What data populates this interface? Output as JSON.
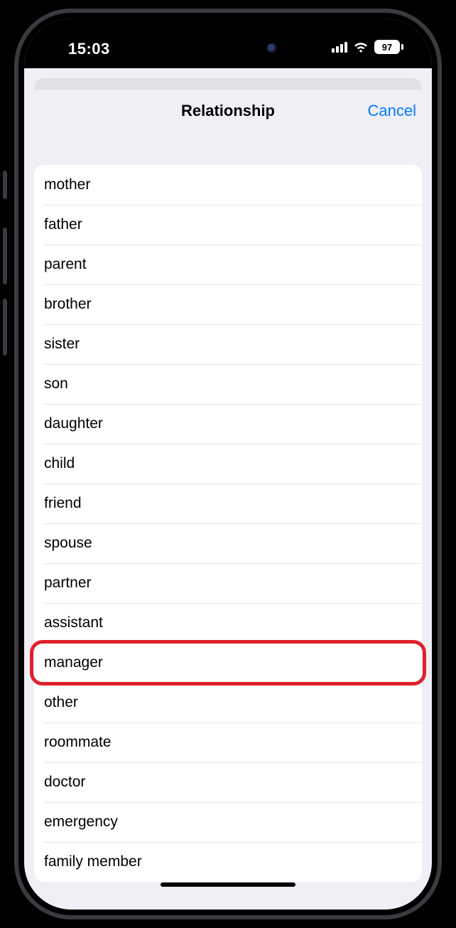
{
  "statusbar": {
    "time": "15:03",
    "battery_pct": "97"
  },
  "navbar": {
    "title": "Relationship",
    "cancel_label": "Cancel"
  },
  "list": {
    "items": [
      "mother",
      "father",
      "parent",
      "brother",
      "sister",
      "son",
      "daughter",
      "child",
      "friend",
      "spouse",
      "partner",
      "assistant",
      "manager",
      "other",
      "roommate",
      "doctor",
      "emergency",
      "family member"
    ],
    "highlighted_index": 12
  },
  "annotation": {
    "color": "#e0202c"
  }
}
